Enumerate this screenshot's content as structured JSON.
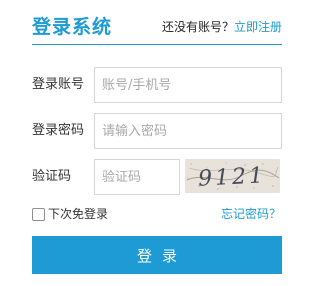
{
  "header": {
    "title": "登录系统",
    "no_account_text": "还没有账号？",
    "register_link": "立即注册"
  },
  "form": {
    "account": {
      "label": "登录账号",
      "placeholder": "账号/手机号",
      "value": ""
    },
    "password": {
      "label": "登录密码",
      "placeholder": "请输入密码",
      "value": ""
    },
    "captcha": {
      "label": "验证码",
      "placeholder": "验证码",
      "value": "",
      "image_text": "9121"
    },
    "remember_label": "下次免登录",
    "remember_checked": false,
    "forgot_link": "忘记密码？",
    "submit_label": "登录"
  },
  "colors": {
    "accent": "#1e9bd4",
    "border": "#d6d6d6",
    "placeholder": "#a8a8a8"
  }
}
